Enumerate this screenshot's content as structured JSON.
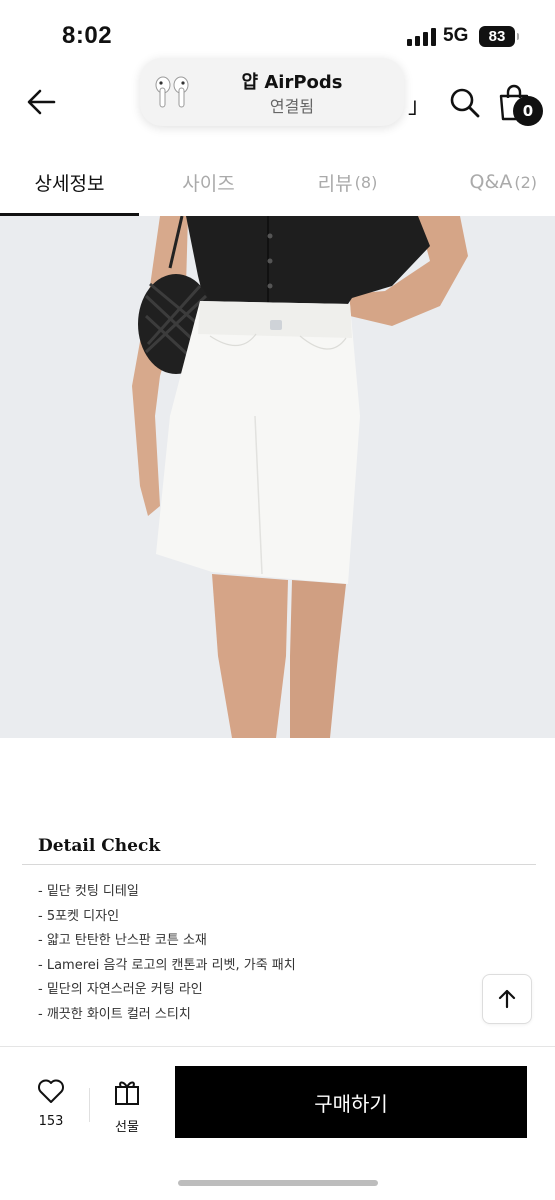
{
  "status_bar": {
    "time": "8:02",
    "network": "5G",
    "battery": "83"
  },
  "airpods_popup": {
    "title": "얍 AirPods",
    "subtitle": "연결됨"
  },
  "header": {
    "partial_text": "」",
    "cart_count": "0"
  },
  "tabs": [
    {
      "label": "상세정보",
      "count": "",
      "active": true
    },
    {
      "label": "사이즈",
      "count": "",
      "active": false
    },
    {
      "label": "리뷰",
      "count": "(8)",
      "active": false
    },
    {
      "label": "Q&A",
      "count": "(2)",
      "active": false
    }
  ],
  "detail": {
    "title": "Detail Check",
    "items": [
      "- 밑단 컷팅 디테일",
      "- 5포켓 디자인",
      "- 얇고 탄탄한 난스판 코튼 소재",
      "- Lamerei 음각 로고의 캔톤과 리벳, 가죽 패치",
      "- 밑단의 자연스러운 커팅 라인",
      "- 깨끗한 화이트 컬러 스티치"
    ]
  },
  "bottom_bar": {
    "like_count": "153",
    "gift_label": "선물",
    "buy_label": "구매하기"
  }
}
